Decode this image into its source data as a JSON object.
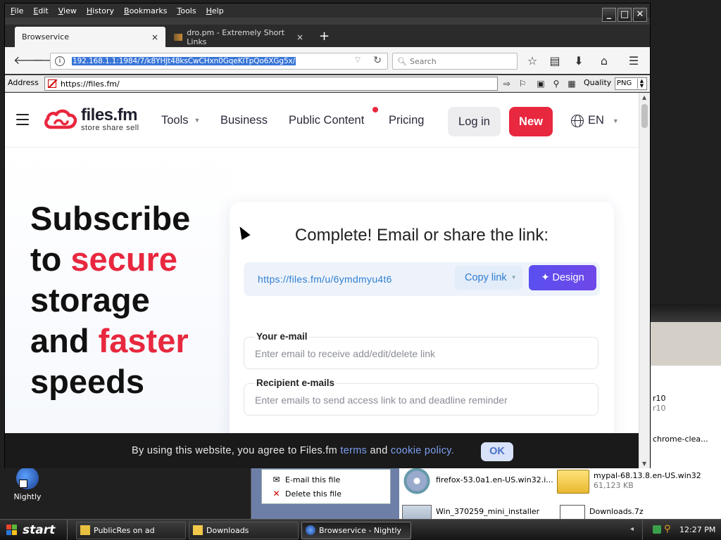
{
  "desktop": {
    "icon_label": "Nightly"
  },
  "explorer": {
    "tasks": [
      {
        "label": "E-mail this file",
        "icon": "email-icon"
      },
      {
        "label": "Delete this file",
        "icon": "delete-icon"
      }
    ],
    "right_items": [
      {
        "label": "r10"
      },
      {
        "label": "r10"
      },
      {
        "label": "chrome-clea..."
      }
    ],
    "files": [
      {
        "name": "firefox-53.0a1.en-US.win32.i...",
        "size": "",
        "icon": "cd-installer-icon"
      },
      {
        "name": "mypal-68.13.8.en-US.win32",
        "size": "61,123 KB",
        "icon": "folder-icon"
      },
      {
        "name": "Win_370259_mini_installer",
        "size": "",
        "icon": "installer-icon"
      },
      {
        "name": "Downloads.7z",
        "size": "",
        "icon": "archive-icon"
      }
    ]
  },
  "browser": {
    "menu": [
      "File",
      "Edit",
      "View",
      "History",
      "Bookmarks",
      "Tools",
      "Help"
    ],
    "window_controls": {
      "minimize": "_",
      "maximize": "□",
      "close": "✕"
    },
    "tabs": [
      {
        "title": "Browservice",
        "active": true,
        "close": "×"
      },
      {
        "title": "dro.pm - Extremely Short Links",
        "active": false,
        "close": "×"
      }
    ],
    "new_tab": "+",
    "url": "192.168.1.1:1984/7/k8YHJt48ksCwCHxn0GqeKlTpQo6XGg5x/",
    "search_placeholder": "Search",
    "address_label": "Address",
    "address_value": "https://files.fm/",
    "quality_label": "Quality",
    "quality_value": "PNG"
  },
  "site": {
    "logo_name": "files.fm",
    "logo_tagline": "store  share  sell",
    "nav": [
      {
        "label": "Tools",
        "has_caret": true
      },
      {
        "label": "Business"
      },
      {
        "label": "Public Content"
      },
      {
        "label": "Pricing"
      }
    ],
    "login": "Log in",
    "new": "New",
    "lang": "EN",
    "hero": {
      "line1": "Subscribe",
      "line2a": "to ",
      "line2b": "secure",
      "line3": "storage",
      "line4a": "and ",
      "line4b": "faster",
      "line5": "speeds"
    },
    "card": {
      "title": "Complete! Email or share the link:",
      "share_url": "https://files.fm/u/6ymdmyu4t6",
      "copy_link": "Copy link",
      "design": "Design",
      "email_label": "Your e-mail",
      "email_placeholder": "Enter email to receive add/edit/delete link",
      "recipients_label": "Recipient e-mails",
      "recipients_placeholder": "Enter emails to send access link to and deadline reminder"
    },
    "cookie": {
      "text1": "By using this website, you agree to Files.fm ",
      "terms": "terms",
      "and": " and ",
      "policy": "cookie policy.",
      "ok": "OK"
    }
  },
  "taskbar": {
    "start": "start",
    "tasks": [
      {
        "label": "PublicRes on ad"
      },
      {
        "label": "Downloads"
      },
      {
        "label": "Browservice - Nightly",
        "active": true
      }
    ],
    "time": "12:27 PM"
  },
  "colors": {
    "accent_red": "#e8283e",
    "link_blue": "#2f7fd0",
    "design_purple": "#5a4ff0"
  }
}
